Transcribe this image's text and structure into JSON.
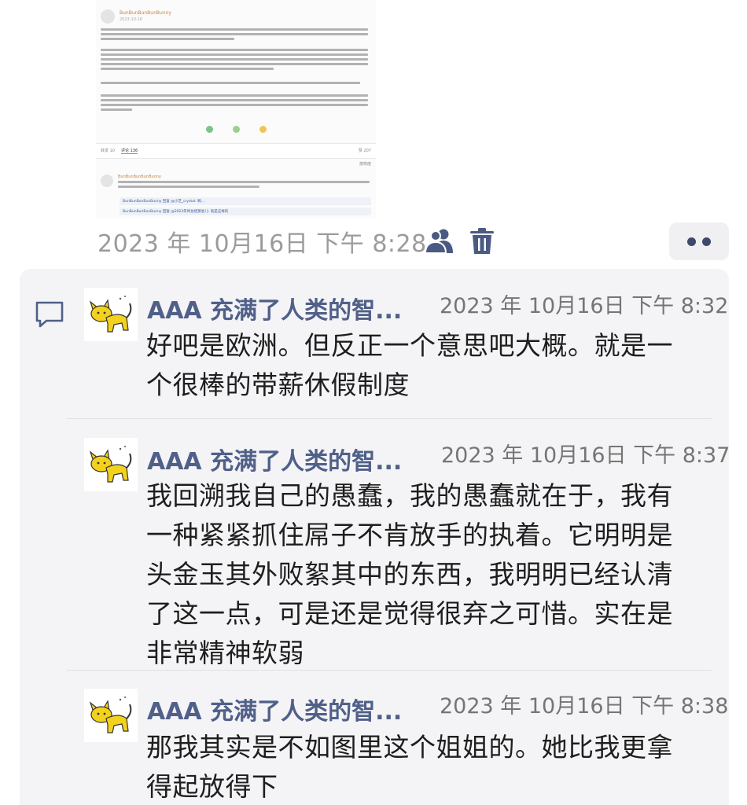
{
  "embedded_screenshot": {
    "username": "BunBunBunBunBunny",
    "date": "2023-10-16",
    "tabs": [
      "转发 10",
      "评论 136",
      "赞 207"
    ],
    "sort_label": "按热度",
    "comment_username": "BunBunBunBunBunny",
    "replies": [
      "BunBunBunBunBunny 回复 @小芝_crystal: 啊…",
      "BunBunBunBunBunny 回复 @2023年终总结那会儿: 就是这样的"
    ]
  },
  "post": {
    "timestamp": "2023 年 10月16日 下午 8:28",
    "visibility_icon": "people-icon",
    "delete_icon": "trash-icon",
    "more_icon": "more-dots-icon"
  },
  "comments": [
    {
      "author": "AAA 充满了人类的智...",
      "time": "2023 年 10月16日 下午 8:32",
      "text": "好吧是欧洲。但反正一个意思吧大概。就是一个很棒的带薪休假制度"
    },
    {
      "author": "AAA 充满了人类的智...",
      "time": "2023 年 10月16日 下午 8:37",
      "text": "我回溯我自己的愚蠢，我的愚蠢就在于，我有一种紧紧抓住屌子不肯放手的执着。它明明是头金玉其外败絮其中的东西，我明明已经认清了这一点，可是还是觉得很弃之可惜。实在是非常精神软弱"
    },
    {
      "author": "AAA 充满了人类的智...",
      "time": "2023 年 10月16日 下午 8:38",
      "text": "那我其实是不如图里这个姐姐的。她比我更拿得起放得下"
    }
  ],
  "colors": {
    "author": "#506089",
    "timestamp": "#9b9b9b",
    "panel_bg": "#f4f4f6",
    "icon": "#3e4a6b"
  }
}
